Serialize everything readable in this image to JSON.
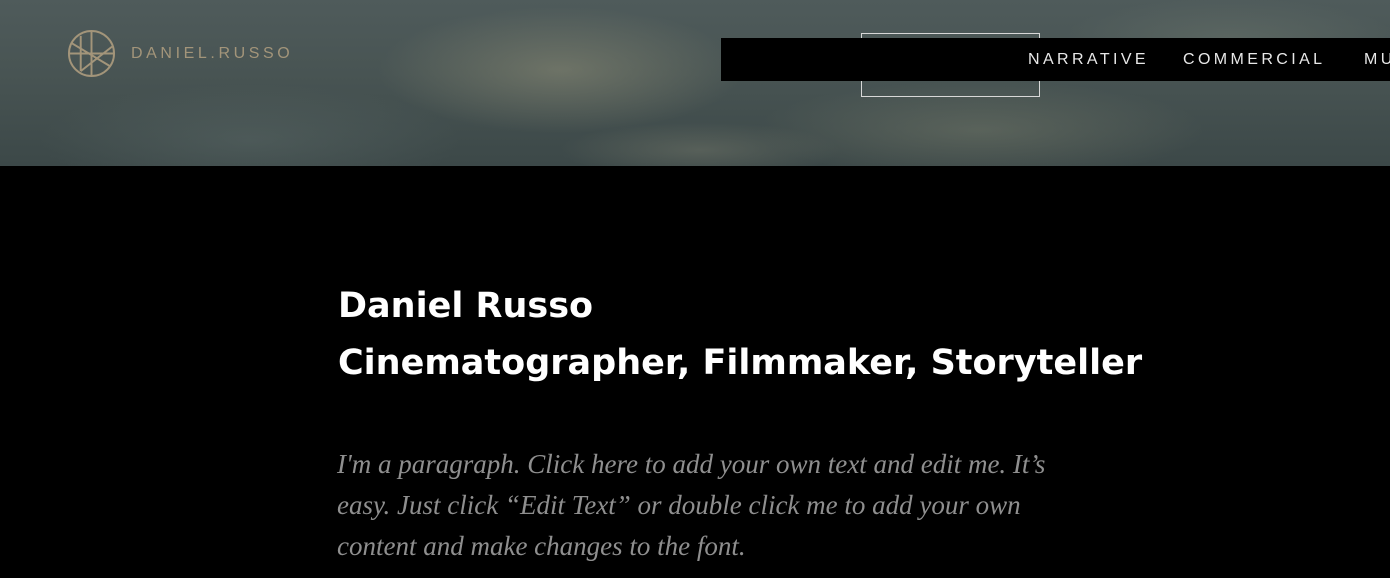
{
  "header": {
    "brand": "DANIEL.RUSSO",
    "brand_color": "#a3957a",
    "logo_icon": "geometric-circle-monogram-icon",
    "nav": [
      {
        "label": "NARRATIVE"
      },
      {
        "label": "COMMERCIAL"
      },
      {
        "label": "MU"
      }
    ]
  },
  "intro": {
    "name": "Daniel Russo",
    "tagline": "Cinematographer, Filmmaker, Storyteller",
    "paragraph_lines": [
      "I'm a paragraph. Click here to add your own text and edit me. It’s",
      "easy. Just click “Edit Text” or double click me to add your own",
      "content and make changes to the font."
    ]
  }
}
